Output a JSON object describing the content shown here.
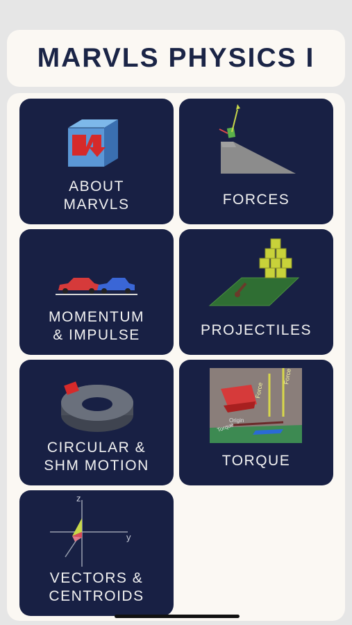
{
  "app": {
    "title": "MARVLS PHYSICS I"
  },
  "tiles": [
    {
      "label": "ABOUT\nMARVLS",
      "icon": "marvls-cube-logo-icon"
    },
    {
      "label": "FORCES",
      "icon": "inclined-plane-icon"
    },
    {
      "label": "MOMENTUM\n& IMPULSE",
      "icon": "colliding-cars-icon"
    },
    {
      "label": "PROJECTILES",
      "icon": "cannon-blocks-icon"
    },
    {
      "label": "CIRCULAR &\nSHM MOTION",
      "icon": "rotating-disc-icon"
    },
    {
      "label": "TORQUE",
      "icon": "torque-cart-icon"
    },
    {
      "label": "VECTORS &\nCENTROIDS",
      "icon": "xyz-axes-icon"
    }
  ],
  "illustration_text": {
    "torque": {
      "force1": "Force",
      "force2": "Force",
      "origin": "Origin",
      "torque": "Torque"
    },
    "vectors": {
      "z": "z",
      "y": "y"
    }
  },
  "colors": {
    "tile": "#182044",
    "panel": "#fbf8f3",
    "title": "#1a2446"
  }
}
